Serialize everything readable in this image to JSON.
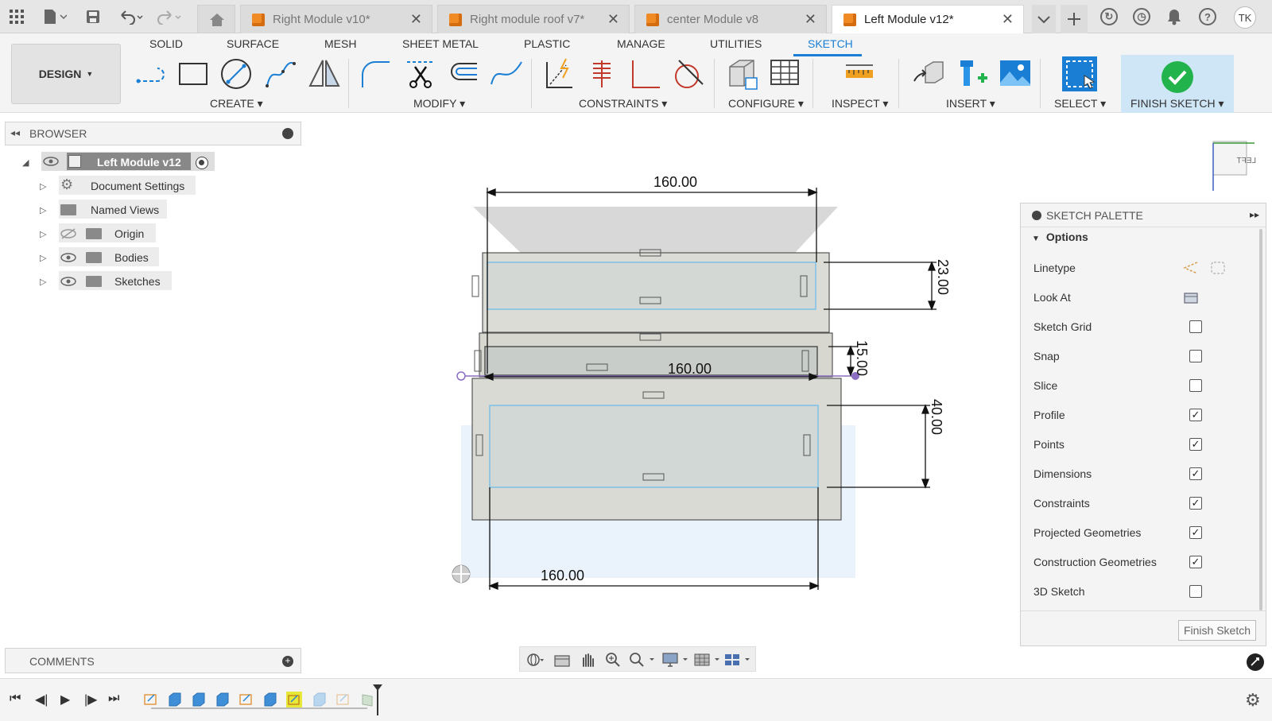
{
  "tabs": [
    {
      "label": "Right Module v10*",
      "active": false
    },
    {
      "label": "Right module roof v7*",
      "active": false
    },
    {
      "label": "center Module v8",
      "active": false
    },
    {
      "label": "Left Module v12*",
      "active": true
    }
  ],
  "user_initials": "TK",
  "menu_tabs": [
    "SOLID",
    "SURFACE",
    "MESH",
    "SHEET METAL",
    "PLASTIC",
    "MANAGE",
    "UTILITIES",
    "SKETCH"
  ],
  "active_menu_tab": "SKETCH",
  "workspace": "DESIGN",
  "groups": {
    "create": "CREATE",
    "modify": "MODIFY",
    "constraints": "CONSTRAINTS",
    "configure": "CONFIGURE",
    "inspect": "INSPECT",
    "insert": "INSERT",
    "select": "SELECT",
    "finish": "FINISH SKETCH"
  },
  "browser": {
    "title": "BROWSER",
    "root": "Left Module v12",
    "items": [
      "Document Settings",
      "Named Views",
      "Origin",
      "Bodies",
      "Sketches"
    ]
  },
  "comments_label": "COMMENTS",
  "dimensions": {
    "top_width": "160.00",
    "mid_width": "160.00",
    "bottom_width": "160.00",
    "h1": "23.00",
    "h2": "15.00",
    "h3": "40.00"
  },
  "viewcube_label": "LEFT",
  "palette": {
    "title": "SKETCH PALETTE",
    "section": "Options",
    "rows": [
      {
        "label": "Linetype",
        "kind": "icons"
      },
      {
        "label": "Look At",
        "kind": "icon"
      },
      {
        "label": "Sketch Grid",
        "checked": false
      },
      {
        "label": "Snap",
        "checked": false
      },
      {
        "label": "Slice",
        "checked": false
      },
      {
        "label": "Profile",
        "checked": true
      },
      {
        "label": "Points",
        "checked": true
      },
      {
        "label": "Dimensions",
        "checked": true
      },
      {
        "label": "Constraints",
        "checked": true
      },
      {
        "label": "Projected Geometries",
        "checked": true
      },
      {
        "label": "Construction Geometries",
        "checked": true
      },
      {
        "label": "3D Sketch",
        "checked": false
      }
    ],
    "finish_button": "Finish Sketch"
  },
  "colors": {
    "accent": "#1a7fd4",
    "finish_green": "#22b34c",
    "selection_blue": "#cfe6f7"
  }
}
